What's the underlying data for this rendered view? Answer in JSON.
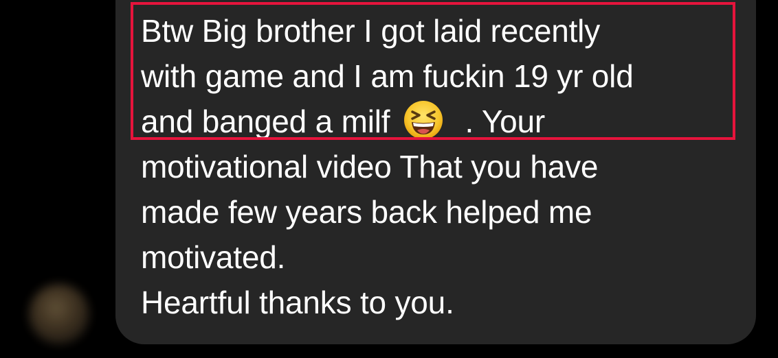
{
  "message": {
    "lines": [
      "Btw Big brother I got laid recently",
      "with game and I am fuckin 19 yr old",
      "and banged a milf",
      ". Your",
      "motivational video That you have",
      "made few years back helped me",
      "motivated.",
      "Heartful thanks to you."
    ],
    "emoji": "grinning-squinting-face-icon"
  },
  "colors": {
    "background": "#000000",
    "bubble": "#262626",
    "text": "#ffffff",
    "highlight": "#e6143c",
    "emoji_face": "#f7c52b"
  }
}
